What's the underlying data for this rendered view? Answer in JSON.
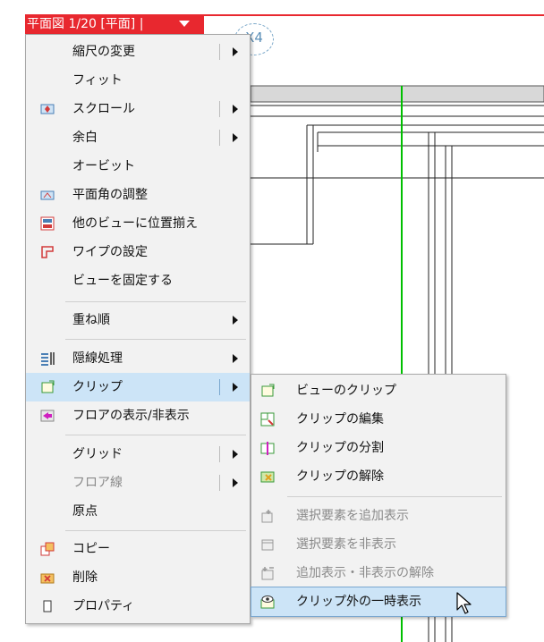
{
  "view_title": "平面図 1/20 [平面] |",
  "grid_bubble": "X4",
  "colors": {
    "title_bar": "#e8282f",
    "grid_line": "#00c000",
    "menu_bg": "#f2f2f2",
    "highlight": "#cce4f7"
  },
  "main_menu": {
    "items": [
      {
        "label": "縮尺の変更",
        "icon": "",
        "submenu": true
      },
      {
        "label": "フィット",
        "icon": ""
      },
      {
        "label": "スクロール",
        "icon": "scroll-icon",
        "submenu": true
      },
      {
        "label": "余白",
        "icon": "",
        "submenu": true
      },
      {
        "label": "オービット",
        "icon": ""
      },
      {
        "label": "平面角の調整",
        "icon": "plane-angle-icon"
      },
      {
        "label": "他のビューに位置揃え",
        "icon": "align-view-icon"
      },
      {
        "label": "ワイプの設定",
        "icon": "wipe-icon"
      },
      {
        "label": "ビューを固定する",
        "icon": ""
      },
      {
        "label": "重ね順",
        "icon": "",
        "submenu": true
      },
      {
        "label": "隠線処理",
        "icon": "hidden-line-icon",
        "submenu": true
      },
      {
        "label": "クリップ",
        "icon": "clip-icon",
        "submenu": true,
        "active": true
      },
      {
        "label": "フロアの表示/非表示",
        "icon": "floor-visibility-icon"
      },
      {
        "label": "グリッド",
        "icon": "",
        "submenu": true
      },
      {
        "label": "フロア線",
        "icon": "",
        "submenu": true,
        "disabled": true
      },
      {
        "label": "原点",
        "icon": ""
      },
      {
        "label": "コピー",
        "icon": "copy-icon"
      },
      {
        "label": "削除",
        "icon": "delete-icon"
      },
      {
        "label": "プロパティ",
        "icon": "properties-icon"
      }
    ]
  },
  "clip_submenu": {
    "items": [
      {
        "label": "ビューのクリップ",
        "icon": "view-clip-icon"
      },
      {
        "label": "クリップの編集",
        "icon": "clip-edit-icon"
      },
      {
        "label": "クリップの分割",
        "icon": "clip-split-icon"
      },
      {
        "label": "クリップの解除",
        "icon": "clip-release-icon"
      },
      {
        "label": "選択要素を追加表示",
        "icon": "add-display-icon",
        "disabled": true
      },
      {
        "label": "選択要素を非表示",
        "icon": "hide-selected-icon",
        "disabled": true
      },
      {
        "label": "追加表示・非表示の解除",
        "icon": "reset-display-icon",
        "disabled": true
      },
      {
        "label": "クリップ外の一時表示",
        "icon": "temp-display-icon",
        "hover": true
      }
    ]
  }
}
